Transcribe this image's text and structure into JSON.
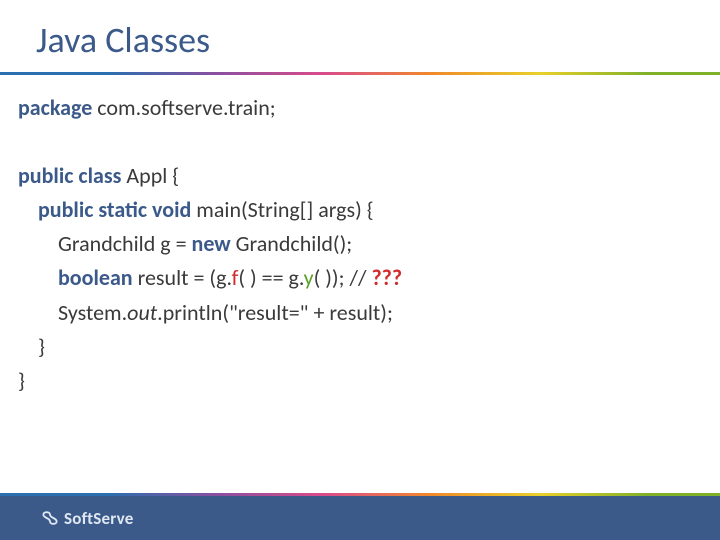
{
  "title": "Java Classes",
  "code": {
    "kw_package": "package",
    "package_name": " com.softserve.train;",
    "kw_public_class": "public class",
    "class_decl": " Appl {",
    "kw_main_mods": "public static void",
    "main_sig": " main(String[] args) {",
    "line_grandchild_pre": "Grandchild g = ",
    "kw_new": "new",
    "line_grandchild_post": " Grandchild();",
    "kw_boolean": "boolean",
    "result_pre": " result = (g.",
    "f_call": "f",
    "mid": "( ) == g.",
    "y_call": "y",
    "result_post": "( ));   // ",
    "question": "???",
    "println_pre": "System.",
    "out": "out",
    "println_post": ".println(\"result=\" + result);",
    "close_inner": "}",
    "close_outer": "}"
  },
  "footer": {
    "brand": "SoftServe"
  }
}
